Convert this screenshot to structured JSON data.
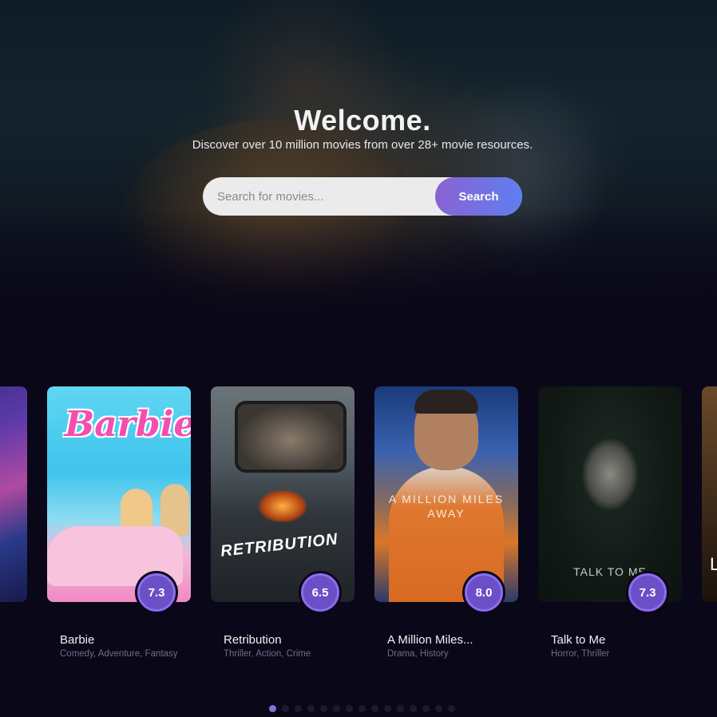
{
  "hero": {
    "title": "Welcome.",
    "subtitle": "Discover over 10 million movies from over 28+ movie resources."
  },
  "search": {
    "placeholder": "Search for movies...",
    "value": "",
    "button_label": "Search",
    "button_gradient": [
      "#8a63d2",
      "#5f7ef0"
    ]
  },
  "carousel": {
    "movies": [
      {
        "title": "",
        "genres": "",
        "rating": "",
        "poster_text": ""
      },
      {
        "title": "Barbie",
        "genres": "Comedy, Adventure, Fantasy",
        "rating": "7.3",
        "poster_text": "Barbie"
      },
      {
        "title": "Retribution",
        "genres": "Thriller, Action, Crime",
        "rating": "6.5",
        "poster_text": "RETRIBUTION"
      },
      {
        "title": "A Million Miles...",
        "genres": "Drama, History",
        "rating": "8.0",
        "poster_text": "A MILLION MILES AWAY"
      },
      {
        "title": "Talk to Me",
        "genres": "Horror, Thriller",
        "rating": "7.3",
        "poster_text": "TALK TO ME"
      },
      {
        "title": "",
        "genres": "",
        "rating": "",
        "poster_text": "L"
      }
    ],
    "dots_count": 15,
    "active_dot": 0
  },
  "colors": {
    "background": "#0a0718",
    "accent": "#8a6ee0",
    "rating_fill": "#6b4fc7"
  }
}
